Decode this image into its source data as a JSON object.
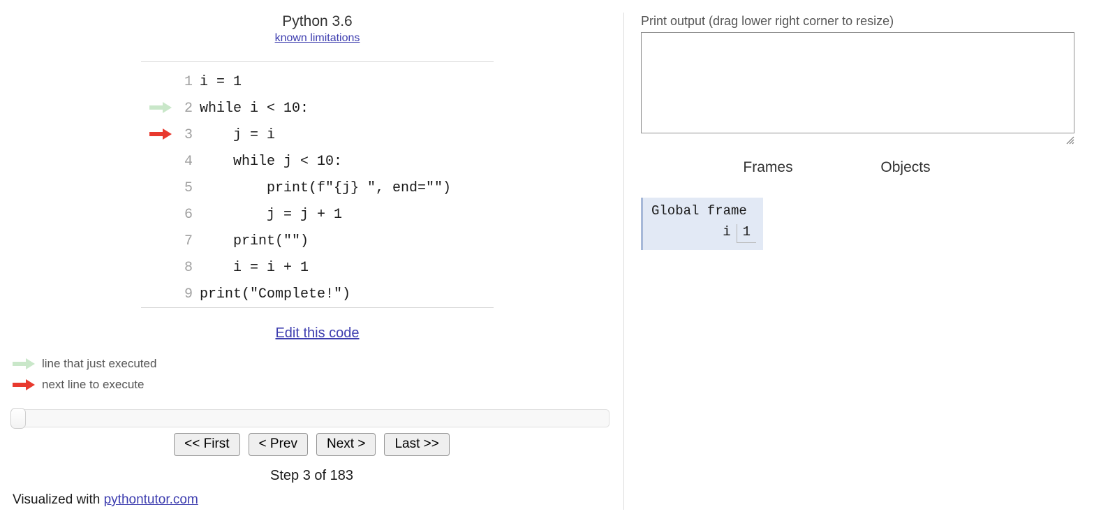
{
  "language": {
    "title": "Python 3.6",
    "limitations_link": "known limitations"
  },
  "code": {
    "lines": [
      {
        "number": "1",
        "text": "i = 1",
        "arrow": "none"
      },
      {
        "number": "2",
        "text": "while i < 10:",
        "arrow": "green"
      },
      {
        "number": "3",
        "text": "    j = i",
        "arrow": "red"
      },
      {
        "number": "4",
        "text": "    while j < 10:",
        "arrow": "none"
      },
      {
        "number": "5",
        "text": "        print(f\"{j} \", end=\"\")",
        "arrow": "none"
      },
      {
        "number": "6",
        "text": "        j = j + 1",
        "arrow": "none"
      },
      {
        "number": "7",
        "text": "    print(\"\")",
        "arrow": "none"
      },
      {
        "number": "8",
        "text": "    i = i + 1",
        "arrow": "none"
      },
      {
        "number": "9",
        "text": "print(\"Complete!\")",
        "arrow": "none"
      }
    ],
    "edit_link": "Edit this code"
  },
  "legend": {
    "just_executed": "line that just executed",
    "next_line": "next line to execute",
    "green_color": "#c9e7c9",
    "red_color": "#e8392e"
  },
  "controls": {
    "first": "<< First",
    "prev": "< Prev",
    "next": "Next >",
    "last": "Last >>",
    "step_counter": "Step 3 of 183",
    "slider_position_percent": 0
  },
  "footer": {
    "prefix": "Visualized with ",
    "link": "pythontutor.com"
  },
  "output": {
    "label": "Print output (drag lower right corner to resize)",
    "value": "",
    "placeholder": ""
  },
  "visualization": {
    "frames_header": "Frames",
    "objects_header": "Objects",
    "frames": [
      {
        "title": "Global frame",
        "background_color": "#e2e9f5",
        "variables": [
          {
            "name": "i",
            "value": "1"
          }
        ]
      }
    ],
    "objects": []
  }
}
